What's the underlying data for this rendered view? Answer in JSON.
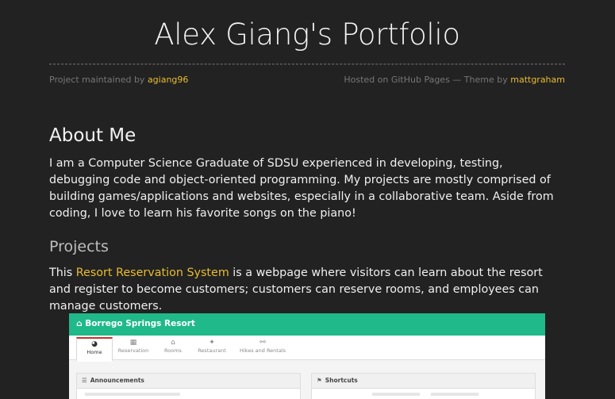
{
  "header": {
    "title": "Alex Giang's Portfolio",
    "maintained_prefix": "Project maintained by ",
    "maintainer": "agiang96",
    "hosted_text": "Hosted on GitHub Pages — Theme by ",
    "theme_author": "mattgraham"
  },
  "about": {
    "heading": "About Me",
    "text": "I am a Computer Science Graduate of SDSU experienced in developing, testing, debugging code and object-oriented programming. My projects are mostly comprised of building games/applications and websites, especially in a collaborative team. Aside from coding, I love to learn his favorite songs on the piano!"
  },
  "projects": {
    "heading": "Projects",
    "intro_prefix": "This ",
    "link_text": "Resort Reservation System",
    "intro_suffix": " is a webpage where visitors can learn about the resort and register to become customers; customers can reserve rooms, and employees can manage customers."
  },
  "screenshot": {
    "brand": "Borrego Springs Resort",
    "brand_icon": "home-icon",
    "tabs": [
      {
        "label": "Home",
        "icon": "dashboard-icon",
        "active": true
      },
      {
        "label": "Reservation",
        "icon": "calendar-icon",
        "active": false
      },
      {
        "label": "Rooms",
        "icon": "bank-icon",
        "active": false
      },
      {
        "label": "Restaurant",
        "icon": "cutlery-icon",
        "active": false
      },
      {
        "label": "Hikes and Rentals",
        "icon": "bicycle-icon",
        "active": false
      }
    ],
    "panels": [
      {
        "title": "Announcements",
        "icon": "list-icon"
      },
      {
        "title": "Shortcuts",
        "icon": "bookmark-icon"
      }
    ],
    "colors": {
      "bar": "#1fb98a",
      "active_tab": "#c9302c"
    }
  },
  "colors": {
    "background": "#222222",
    "link": "#e8bd2e",
    "text": "#f0f0f0"
  }
}
